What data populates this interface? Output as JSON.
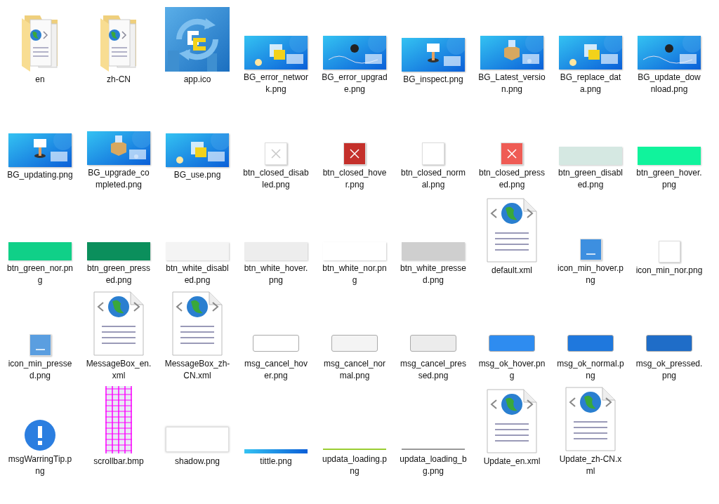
{
  "items": [
    {
      "name": "en",
      "kind": "folder"
    },
    {
      "name": "zh-CN",
      "kind": "folder"
    },
    {
      "name": "app.ico",
      "kind": "app"
    },
    {
      "name": "BG_error_network.png",
      "kind": "picture"
    },
    {
      "name": "BG_error_upgrade.png",
      "kind": "picture"
    },
    {
      "name": "BG_inspect.png",
      "kind": "picture"
    },
    {
      "name": "BG_Latest_version.png",
      "kind": "picture"
    },
    {
      "name": "BG_replace_data.png",
      "kind": "picture"
    },
    {
      "name": "BG_update_download.png",
      "kind": "picture"
    },
    {
      "name": "BG_updating.png",
      "kind": "picture"
    },
    {
      "name": "BG_upgrade_completed.png",
      "kind": "picture"
    },
    {
      "name": "BG_use.png",
      "kind": "picture"
    },
    {
      "name": "btn_closed_disabled.png",
      "kind": "close",
      "color": "#ffffff",
      "disabled": true
    },
    {
      "name": "btn_closed_hover.png",
      "kind": "close",
      "color": "#c4302b",
      "disabled": false
    },
    {
      "name": "btn_closed_normal.png",
      "kind": "close",
      "color": "#ffffff",
      "disabled": false
    },
    {
      "name": "btn_closed_pressed.png",
      "kind": "close",
      "color": "#ef5c55",
      "disabled": false
    },
    {
      "name": "btn_green_disabled.png",
      "kind": "wide",
      "color": "#d5e8e2"
    },
    {
      "name": "btn_green_hover.png",
      "kind": "wide",
      "color": "#10f39c"
    },
    {
      "name": "btn_green_nor.png",
      "kind": "wide",
      "color": "#10d088"
    },
    {
      "name": "btn_green_pressed.png",
      "kind": "wide",
      "color": "#0b8f5c"
    },
    {
      "name": "btn_white_disabled.png",
      "kind": "wide",
      "color": "#f4f4f4"
    },
    {
      "name": "btn_white_hover.png",
      "kind": "wide",
      "color": "#ededed"
    },
    {
      "name": "btn_white_nor.png",
      "kind": "wide",
      "color": "#ffffff"
    },
    {
      "name": "btn_white_pressed.png",
      "kind": "wide",
      "color": "#cfcfcf"
    },
    {
      "name": "default.xml",
      "kind": "document"
    },
    {
      "name": "icon_min_hover.png",
      "kind": "minimize",
      "color": "#3d8fe0"
    },
    {
      "name": "icon_min_nor.png",
      "kind": "minimize",
      "color": "#ffffff"
    },
    {
      "name": "icon_min_pressed.png",
      "kind": "minimize",
      "color": "#5a9ee0"
    },
    {
      "name": "MessageBox_en.xml",
      "kind": "document"
    },
    {
      "name": "MessageBox_zh-CN.xml",
      "kind": "document"
    },
    {
      "name": "msg_cancel_hover.png",
      "kind": "message",
      "color": "#ffffff"
    },
    {
      "name": "msg_cancel_normal.png",
      "kind": "message",
      "color": "#f4f4f4"
    },
    {
      "name": "msg_cancel_pressed.png",
      "kind": "message",
      "color": "#ececec"
    },
    {
      "name": "msg_ok_hover.png",
      "kind": "message",
      "color": "#2e8cf0"
    },
    {
      "name": "msg_ok_normal.png",
      "kind": "message",
      "color": "#1f78dd"
    },
    {
      "name": "msg_ok_pressed.png",
      "kind": "message",
      "color": "#1f6dc8"
    },
    {
      "name": "msgWarringTip.png",
      "kind": "warning"
    },
    {
      "name": "scrollbar.bmp",
      "kind": "scrollbar"
    },
    {
      "name": "shadow.png",
      "kind": "shadow"
    },
    {
      "name": "tittle.png",
      "kind": "titlebar"
    },
    {
      "name": "updata_loading.png",
      "kind": "line",
      "color": "#9acd32"
    },
    {
      "name": "updata_loading_bg.png",
      "kind": "line",
      "color": "#999999"
    },
    {
      "name": "Update_en.xml",
      "kind": "document"
    },
    {
      "name": "Update_zh-CN.xml",
      "kind": "document"
    }
  ]
}
